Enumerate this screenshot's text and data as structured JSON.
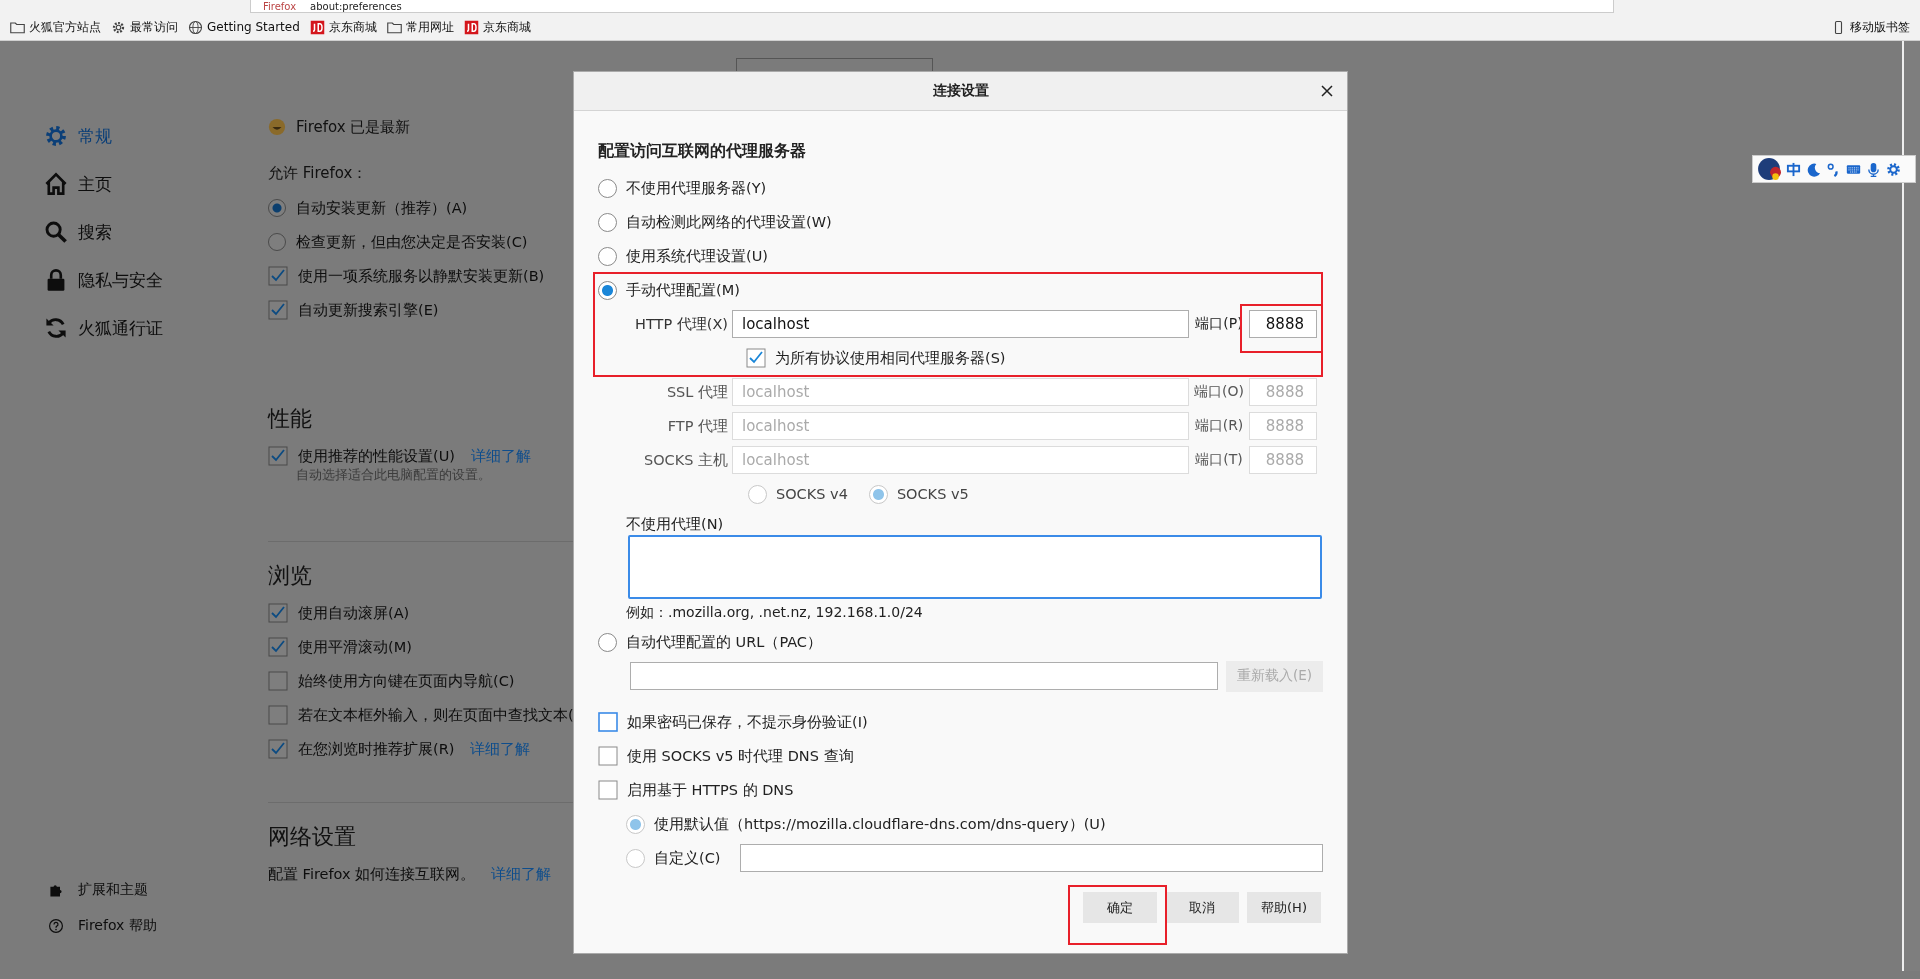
{
  "browser": {
    "tab_label": "Firefox",
    "url": "about:preferences",
    "bookmarks": [
      {
        "label": "火狐官方站点",
        "kind": "folder"
      },
      {
        "label": "最常访问",
        "kind": "gear"
      },
      {
        "label": "Getting Started",
        "kind": "globe"
      },
      {
        "label": "京东商城",
        "kind": "jd"
      },
      {
        "label": "常用网址",
        "kind": "folder"
      },
      {
        "label": "京东商城",
        "kind": "jd"
      }
    ],
    "mobile_bookmarks": "移动版书签"
  },
  "sidebar": {
    "items": [
      {
        "label": "常规",
        "kind": "gear",
        "selected": true
      },
      {
        "label": "主页",
        "kind": "home",
        "selected": false
      },
      {
        "label": "搜索",
        "kind": "search",
        "selected": false
      },
      {
        "label": "隐私与安全",
        "kind": "lock",
        "selected": false
      },
      {
        "label": "火狐通行证",
        "kind": "sync",
        "selected": false
      }
    ],
    "footer": [
      {
        "label": "扩展和主题",
        "kind": "puzzle"
      },
      {
        "label": "Firefox 帮助",
        "kind": "help"
      }
    ]
  },
  "settings": {
    "items": [
      {
        "kind": "status",
        "label": "Firefox 已是最新"
      },
      {
        "kind": "label",
        "label": "允许 Firefox："
      },
      {
        "kind": "radio",
        "label": "自动安装更新（推荐）(A)",
        "selected": true
      },
      {
        "kind": "radio",
        "label": "检查更新，但由您决定是否安装(C)",
        "selected": false
      },
      {
        "kind": "checkbox",
        "label": "使用一项系统服务以静默安装更新(B)",
        "checked": true
      },
      {
        "kind": "checkbox",
        "label": "自动更新搜索引擎(E)",
        "checked": true
      },
      {
        "kind": "heading",
        "label": "性能"
      },
      {
        "kind": "checkbox",
        "label": "使用推荐的性能设置(U)",
        "checked": true,
        "link": "详细了解"
      },
      {
        "kind": "note",
        "label": "自动选择适合此电脑配置的设置。"
      },
      {
        "kind": "heading",
        "label": "浏览"
      },
      {
        "kind": "checkbox",
        "label": "使用自动滚屏(A)",
        "checked": true
      },
      {
        "kind": "checkbox",
        "label": "使用平滑滚动(M)",
        "checked": true
      },
      {
        "kind": "checkbox",
        "label": "始终使用方向键在页面内导航(C)",
        "checked": false
      },
      {
        "kind": "checkbox",
        "label": "若在文本框外输入，则在页面中查找文本(",
        "checked": false
      },
      {
        "kind": "checkbox",
        "label": "在您浏览时推荐扩展(R)",
        "checked": true,
        "link": "详细了解"
      },
      {
        "kind": "heading",
        "label": "网络设置"
      },
      {
        "kind": "text",
        "label": "配置 Firefox 如何连接互联网。",
        "link": "详细了解"
      }
    ]
  },
  "dialog": {
    "title": "连接设置",
    "heading": "配置访问互联网的代理服务器",
    "proxy_modes": [
      {
        "kind": "plain",
        "label": "不使用代理服务器(Y)",
        "selected": false
      },
      {
        "kind": "plain",
        "label": "自动检测此网络的代理设置(W)",
        "selected": false
      },
      {
        "kind": "plain",
        "label": "使用系统代理设置(U)",
        "selected": false
      },
      {
        "kind": "manual",
        "label": "手动代理配置(M)",
        "selected": true
      },
      {
        "kind": "pac",
        "label": "自动代理配置的 URL（PAC）",
        "selected": false
      }
    ],
    "http": {
      "label": "HTTP 代理(X)",
      "value": "localhost",
      "port_label": "端口(P)",
      "port": "8888"
    },
    "share_all": {
      "label": "为所有协议使用相同代理服务器(S)",
      "checked": true
    },
    "other_proxies": [
      {
        "label": "SSL 代理",
        "value": "localhost",
        "port_label": "端口(O)",
        "port": "8888",
        "disabled": true
      },
      {
        "label": "FTP 代理",
        "value": "localhost",
        "port_label": "端口(R)",
        "port": "8888",
        "disabled": true
      },
      {
        "label": "SOCKS 主机",
        "value": "localhost",
        "port_label": "端口(T)",
        "port": "8888",
        "disabled": true
      }
    ],
    "socks_versions": [
      {
        "label": "SOCKS v4",
        "selected": false
      },
      {
        "label": "SOCKS v5",
        "selected": true
      }
    ],
    "no_proxy_label": "不使用代理(N)",
    "example": "例如：.mozilla.org, .net.nz, 192.168.1.0/24",
    "reload_button": {
      "label": "重新载入(E)",
      "disabled": true
    },
    "checkboxes": [
      {
        "label": "如果密码已保存，不提示身份验证(I)",
        "checked": false,
        "focused": true
      },
      {
        "label": "使用 SOCKS v5 时代理 DNS 查询",
        "checked": false,
        "focused": false
      },
      {
        "label": "启用基于 HTTPS 的 DNS",
        "checked": false,
        "focused": false
      }
    ],
    "doh_options": [
      {
        "kind": "default",
        "label": "使用默认值（https://mozilla.cloudflare-dns.com/dns-query）(U)",
        "selected": true,
        "disabled": true
      },
      {
        "kind": "custom",
        "label": "自定义(C)",
        "selected": false,
        "disabled": true
      }
    ],
    "buttons": [
      "确定",
      "取消",
      "帮助(H)"
    ]
  }
}
